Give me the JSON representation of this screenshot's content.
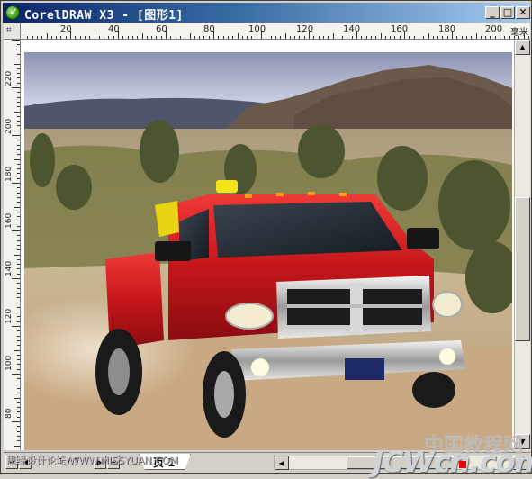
{
  "window": {
    "title": "CorelDRAW X3 - [图形1]",
    "buttons": {
      "minimize": "_",
      "maximize": "□",
      "close": "✕"
    }
  },
  "ruler": {
    "unit": "毫米",
    "horizontal_labels": [
      "20",
      "40",
      "60",
      "80",
      "100",
      "120",
      "140",
      "160",
      "180",
      "200"
    ],
    "vertical_labels": [
      "220",
      "200",
      "180",
      "160",
      "140",
      "120",
      "100",
      "80"
    ]
  },
  "status_bar": {
    "page_count": "1 / 1",
    "page_tab": "页 1"
  },
  "watermarks": {
    "left": "思缘设计论坛 WWW.MISSYUAN.COM",
    "cn": "中国教程网",
    "en": "JCWcn.com"
  },
  "colors": {
    "titlebar_start": "#0a246a",
    "titlebar_end": "#a6caf0",
    "truck_body": "#d11a1e",
    "chrome_frame": "#d4d0c8"
  }
}
